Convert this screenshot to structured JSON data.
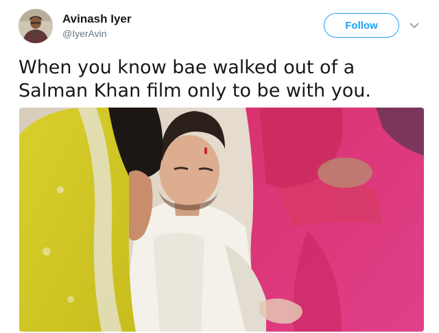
{
  "tweet": {
    "author": {
      "name": "Avinash Iyer",
      "handle": "@IyerAvin"
    },
    "follow_label": "Follow",
    "text": "When you know bae walked out of a Salman Khan film only to be with you.",
    "icons": {
      "caret": "chevron-down-icon"
    },
    "colors": {
      "accent": "#1da1f2",
      "handle": "#657786",
      "text": "#14171a"
    }
  }
}
